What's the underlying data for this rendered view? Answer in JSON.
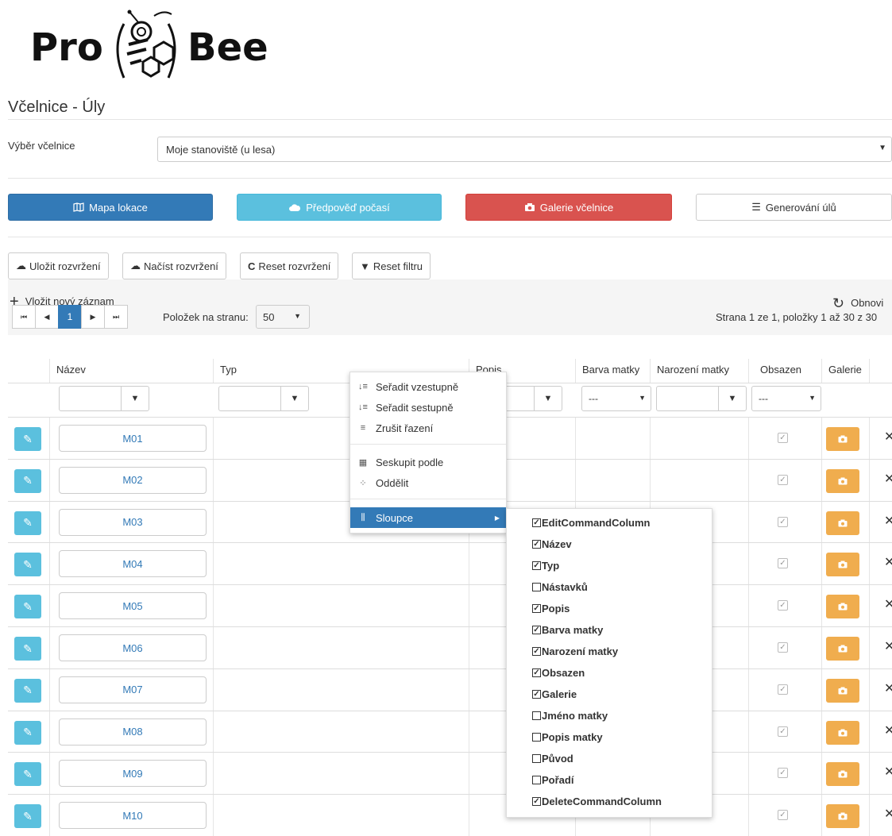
{
  "logo": {
    "left_text": "Pro",
    "right_text": "Bee"
  },
  "page_title": "Včelnice - Úly",
  "selector": {
    "label": "Výběr včelnice",
    "value": "Moje stanoviště (u lesa)"
  },
  "actions": {
    "map": "Mapa lokace",
    "weather": "Předpověď počasí",
    "gallery": "Galerie včelnice",
    "generate": "Generování úlů"
  },
  "layout_buttons": {
    "save": "Uložit rozvržení",
    "load": "Načíst rozvržení",
    "reset_layout": "Reset rozvržení",
    "reset_filter": "Reset filtru"
  },
  "toolbar": {
    "add": "Vložit nový záznam",
    "refresh": "Obnovi"
  },
  "pager": {
    "current_page": "1",
    "per_page_label": "Položek na stranu:",
    "per_page_value": "50",
    "info": "Strana 1 ze 1, položky 1 až 30 z 30"
  },
  "columns": {
    "name": "Název",
    "type": "Typ",
    "desc": "Popis",
    "queen_color": "Barva matky",
    "queen_birth": "Narození matky",
    "occupied": "Obsazen",
    "gallery": "Galerie"
  },
  "filters": {
    "queen_color": "---",
    "occupied": "---"
  },
  "rows": [
    {
      "name": "M01"
    },
    {
      "name": "M02"
    },
    {
      "name": "M03"
    },
    {
      "name": "M04"
    },
    {
      "name": "M05"
    },
    {
      "name": "M06"
    },
    {
      "name": "M07"
    },
    {
      "name": "M08"
    },
    {
      "name": "M09"
    },
    {
      "name": "M10"
    }
  ],
  "context_menu": {
    "sort_asc": "Seřadit vzestupně",
    "sort_desc": "Seřadit sestupně",
    "clear_sort": "Zrušit řazení",
    "group_by": "Seskupit podle",
    "ungroup": "Oddělit",
    "columns": "Sloupce"
  },
  "columns_submenu": [
    {
      "label": "EditCommandColumn",
      "checked": true
    },
    {
      "label": "Název",
      "checked": true
    },
    {
      "label": "Typ",
      "checked": true
    },
    {
      "label": "Nástavků",
      "checked": false
    },
    {
      "label": "Popis",
      "checked": true
    },
    {
      "label": "Barva matky",
      "checked": true
    },
    {
      "label": "Narození matky",
      "checked": true
    },
    {
      "label": "Obsazen",
      "checked": true
    },
    {
      "label": "Galerie",
      "checked": true
    },
    {
      "label": "Jméno matky",
      "checked": false
    },
    {
      "label": "Popis matky",
      "checked": false
    },
    {
      "label": "Původ",
      "checked": false
    },
    {
      "label": "Pořadí",
      "checked": false
    },
    {
      "label": "DeleteCommandColumn",
      "checked": true
    }
  ],
  "colors": {
    "primary": "#337ab7",
    "info": "#5bc0de",
    "danger": "#d9534f",
    "warning": "#f0ad4e"
  }
}
